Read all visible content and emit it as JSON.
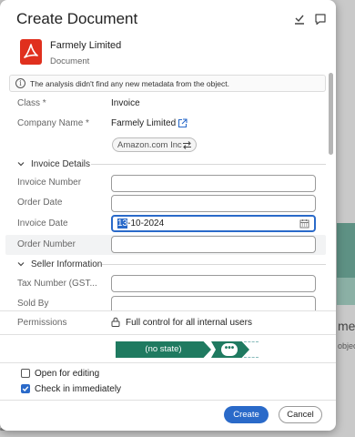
{
  "background": {
    "text_large": "me",
    "text_small": "objec"
  },
  "dialog": {
    "title": "Create Document",
    "header_icons": [
      "download-check-icon",
      "comment-icon"
    ]
  },
  "document": {
    "name": "Farmely Limited",
    "type": "Document",
    "icon": "pdf-icon",
    "icon_color": "#e0301e"
  },
  "info": {
    "message": "The analysis didn't find any new metadata from the object."
  },
  "metadata": {
    "class_label": "Class *",
    "class_value": "Invoice",
    "company_label": "Company Name *",
    "company_value": "Farmely Limited",
    "company_suggestion": "Amazon.com Inc"
  },
  "invoice_details": {
    "section_title": "Invoice Details",
    "fields": [
      {
        "label": "Invoice Number",
        "value": ""
      },
      {
        "label": "Order Date",
        "value": ""
      },
      {
        "label": "Invoice Date",
        "value_selected": "13",
        "value_rest": "-10-2024"
      },
      {
        "label": "Order Number",
        "value": ""
      }
    ]
  },
  "seller_information": {
    "section_title": "Seller Information",
    "fields": [
      {
        "label": "Tax Number (GST...",
        "value": ""
      },
      {
        "label": "Sold By",
        "value": ""
      }
    ]
  },
  "permissions": {
    "label": "Permissions",
    "value": "Full control for all internal users"
  },
  "workflow": {
    "state": "(no state)",
    "more": "•••",
    "color": "#1f7a60"
  },
  "options": {
    "open_for_editing": {
      "label": "Open for editing",
      "checked": false
    },
    "check_in": {
      "label": "Check in immediately",
      "checked": true
    }
  },
  "buttons": {
    "create": "Create",
    "cancel": "Cancel"
  },
  "colors": {
    "accent": "#2a6ac9",
    "workflow": "#1f7a60"
  }
}
